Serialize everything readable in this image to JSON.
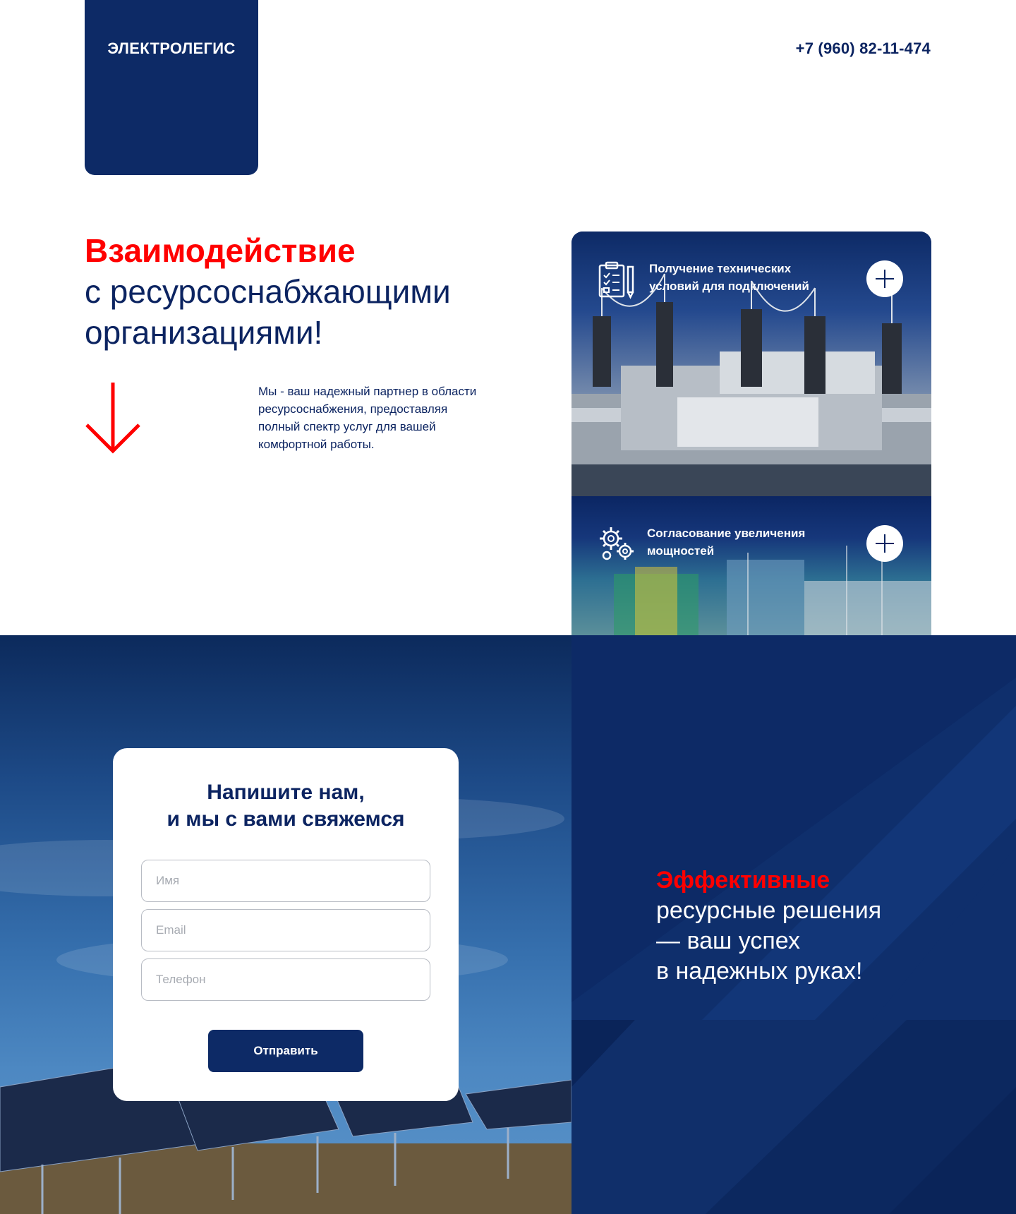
{
  "header": {
    "logo": "ЭЛЕКТРОЛЕГИС",
    "phone": "+7 (960) 82-11-474"
  },
  "hero": {
    "title_accent": "Взаимодействие",
    "title_lines": [
      "с ресурсоснабжающими",
      "организациями!"
    ],
    "lead_lines": [
      "Мы - ваш надежный партнер в области",
      "ресурсоснабжения, предоставляя",
      "полный спектр услуг для вашей",
      "комфортной работы."
    ]
  },
  "services": [
    {
      "title_lines": [
        "Получение технических",
        "условий для подключений"
      ],
      "icon": "clipboard-checklist-icon"
    },
    {
      "title_lines": [
        "Согласование увеличения",
        "мощностей"
      ],
      "icon": "gears-icon"
    }
  ],
  "contact_form": {
    "title_lines": [
      "Напишите нам,",
      "и мы с вами свяжемся"
    ],
    "name_placeholder": "Имя",
    "email_placeholder": "Email",
    "phone_placeholder": "Телефон",
    "submit_label": "Отправить"
  },
  "slogan": {
    "accent": "Эффективные",
    "lines": [
      "ресурсные решения",
      "— ваш успех",
      "в надежных руках!"
    ]
  },
  "colors": {
    "brand_navy": "#0d2a66",
    "accent_red": "#ff0000",
    "text_navy": "#0c2461"
  }
}
